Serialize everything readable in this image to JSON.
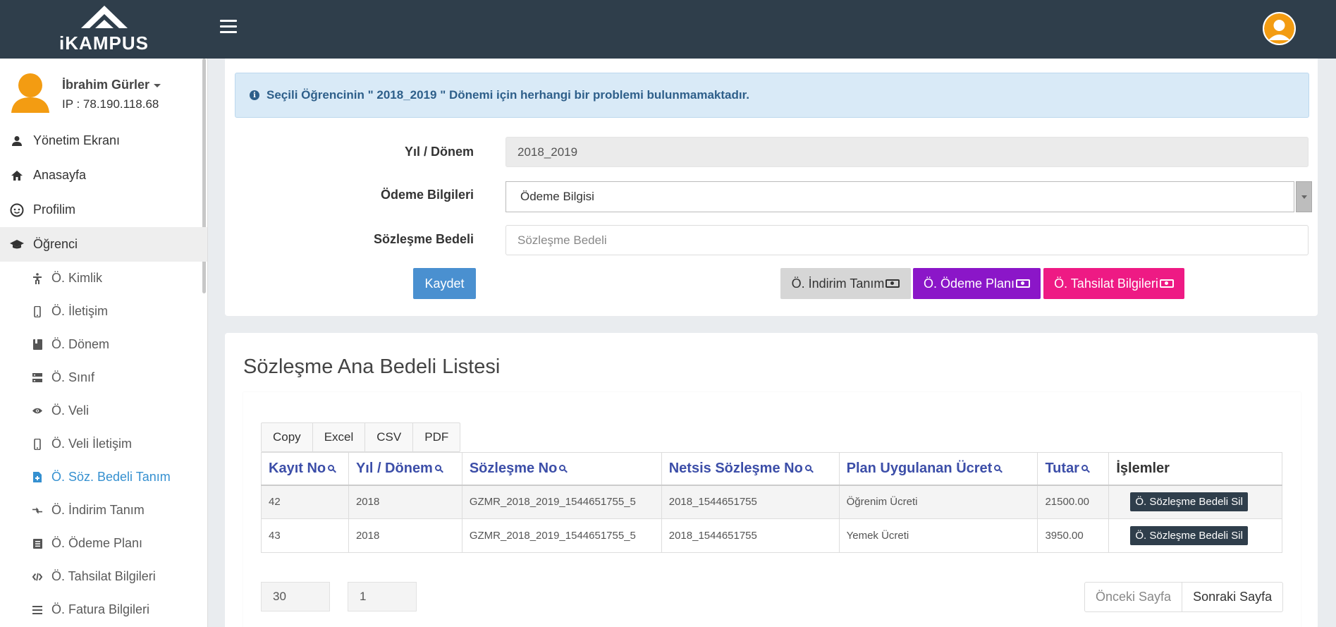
{
  "app": {
    "logo_text": "iKAMPUS"
  },
  "user": {
    "name": "İbrahim Gürler",
    "ip": "IP : 78.190.118.68"
  },
  "sidebar": {
    "items": [
      {
        "label": "Yönetim Ekranı",
        "icon": "person-icon"
      },
      {
        "label": "Anasayfa",
        "icon": "home-icon"
      },
      {
        "label": "Profilim",
        "icon": "face-icon"
      },
      {
        "label": "Öğrenci",
        "icon": "graduation-cap-icon"
      }
    ],
    "subitems": [
      {
        "label": "Ö. Kimlik",
        "icon": "accessibility-icon"
      },
      {
        "label": "Ö. İletişim",
        "icon": "phone-icon"
      },
      {
        "label": "Ö. Dönem",
        "icon": "book-icon"
      },
      {
        "label": "Ö. Sınıf",
        "icon": "storage-icon"
      },
      {
        "label": "Ö. Veli",
        "icon": "eye-icon"
      },
      {
        "label": "Ö. Veli İletişim",
        "icon": "phone-icon"
      },
      {
        "label": "Ö. Söz. Bedeli Tanım",
        "icon": "file-icon"
      },
      {
        "label": "Ö. İndirim Tanım",
        "icon": "swap-icon"
      },
      {
        "label": "Ö. Ödeme Planı",
        "icon": "list-box-icon"
      },
      {
        "label": "Ö. Tahsilat Bilgileri",
        "icon": "code-icon"
      },
      {
        "label": "Ö. Fatura Bilgileri",
        "icon": "lines-icon"
      }
    ]
  },
  "alert": {
    "text": "Seçili Öğrencinin \" 2018_2019 \" Dönemi için herhangi bir problemi bulunmamaktadır."
  },
  "form": {
    "year_label": "Yıl / Dönem",
    "year_value": "2018_2019",
    "payment_label": "Ödeme Bilgileri",
    "payment_value": "Ödeme Bilgisi",
    "contract_label": "Sözleşme Bedeli",
    "contract_placeholder": "Sözleşme Bedeli",
    "save_label": "Kaydet",
    "discount_label": "Ö. İndirim Tanım",
    "plan_label": "Ö. Ödeme Planı",
    "collection_label": "Ö. Tahsilat Bilgileri"
  },
  "colors": {
    "topbar": "#2f3e4b",
    "save": "#4a90d0",
    "discount": "#d6d6d6",
    "plan": "#8b16c8",
    "collection": "#ee1a84",
    "link": "#3590d0"
  },
  "list": {
    "title": "Sözleşme Ana Bedeli Listesi",
    "export_buttons": [
      "Copy",
      "Excel",
      "CSV",
      "PDF"
    ],
    "columns": [
      "Kayıt No",
      "Yıl / Dönem",
      "Sözleşme No",
      "Netsis Sözleşme No",
      "Plan Uygulanan Ücret",
      "Tutar",
      "İşlemler"
    ],
    "rows": [
      {
        "id": "42",
        "year": "2018",
        "contract": "GZMR_2018_2019_1544651755_5",
        "netsis": "2018_1544651755",
        "plan": "Öğrenim Ücreti",
        "amount": "21500.00",
        "action": "Ö. Sözleşme Bedeli Sil"
      },
      {
        "id": "43",
        "year": "2018",
        "contract": "GZMR_2018_2019_1544651755_5",
        "netsis": "2018_1544651755",
        "plan": "Yemek Ücreti",
        "amount": "3950.00",
        "action": "Ö. Sözleşme Bedeli Sil"
      }
    ],
    "page_size": "30",
    "page_number": "1",
    "prev_label": "Önceki Sayfa",
    "next_label": "Sonraki Sayfa"
  }
}
